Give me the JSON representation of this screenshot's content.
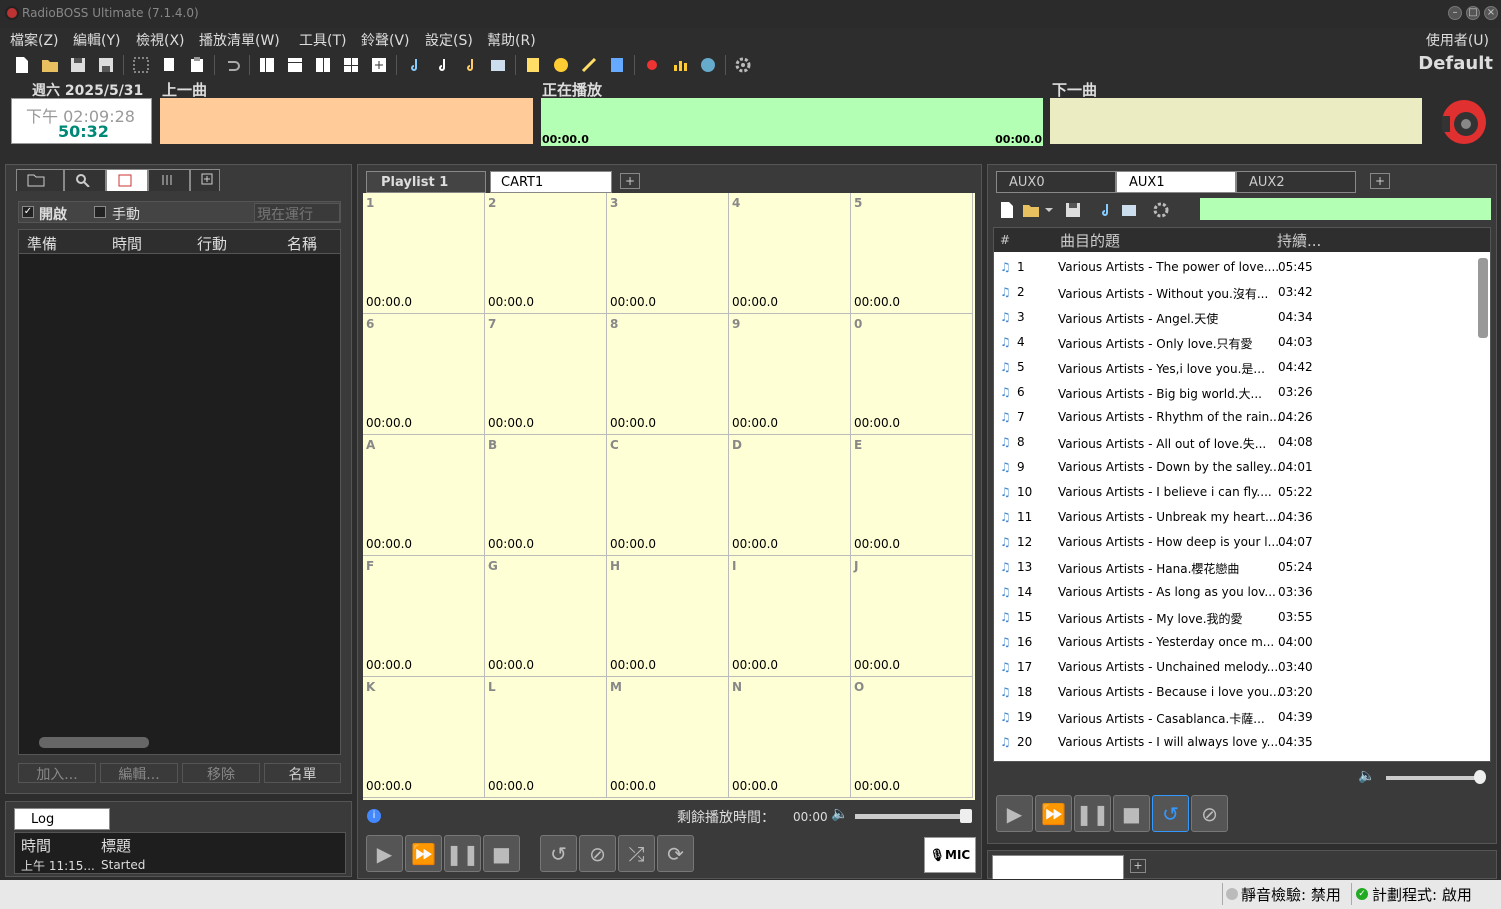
{
  "window": {
    "title": "RadioBOSS Ultimate (7.1.4.0)"
  },
  "menu": {
    "items": [
      "檔案(Z)",
      "編輯(Y)",
      "檢視(X)",
      "播放清單(W)",
      "工具(T)",
      "鈴聲(V)",
      "設定(S)",
      "幫助(R)"
    ],
    "user": "使用者(U)"
  },
  "profile": "Default",
  "clock": {
    "date": "週六 2025/5/31",
    "time": "下午 02:09:28",
    "countdown": "50:32"
  },
  "headers": {
    "previous": "上一曲",
    "now_playing": "正在播放",
    "next": "下一曲"
  },
  "now_playing": {
    "elapsed": "00:00.0",
    "remaining": "00:00.0"
  },
  "scheduler": {
    "enabled_label": "開啟",
    "manual_label": "手動",
    "run_now": "現在運行",
    "columns": [
      "準備",
      "時間",
      "行動",
      "名稱"
    ],
    "buttons": [
      "加入...",
      "編輯...",
      "移除",
      "名單"
    ]
  },
  "log": {
    "tab": "Log",
    "columns": [
      "時間",
      "標題"
    ],
    "entries": [
      {
        "time": "上午 11:15...",
        "title": "Started"
      }
    ]
  },
  "center": {
    "tabs": [
      "Playlist 1",
      "CART1"
    ],
    "remaining_label": "剩餘播放時間：",
    "remaining_value": "00:00",
    "mic_label": "MIC",
    "carts": [
      "1",
      "2",
      "3",
      "4",
      "5",
      "6",
      "7",
      "8",
      "9",
      "0",
      "A",
      "B",
      "C",
      "D",
      "E",
      "F",
      "G",
      "H",
      "I",
      "J",
      "K",
      "L",
      "M",
      "N",
      "O"
    ],
    "cart_time": "00:00.0"
  },
  "right": {
    "tabs": [
      "AUX0",
      "AUX1",
      "AUX2"
    ],
    "columns": [
      "#",
      "曲目的題",
      "持續..."
    ],
    "tracks": [
      {
        "n": "1",
        "title": "Various Artists - The power of love....",
        "dur": "05:45"
      },
      {
        "n": "2",
        "title": "Various Artists - Without you.沒有...",
        "dur": "03:42"
      },
      {
        "n": "3",
        "title": "Various Artists - Angel.天使",
        "dur": "04:34"
      },
      {
        "n": "4",
        "title": "Various Artists - Only love.只有愛",
        "dur": "04:03"
      },
      {
        "n": "5",
        "title": "Various Artists - Yes,i love you.是...",
        "dur": "04:42"
      },
      {
        "n": "6",
        "title": "Various Artists - Big big world.大...",
        "dur": "03:26"
      },
      {
        "n": "7",
        "title": "Various Artists - Rhythm of the rain....",
        "dur": "04:26"
      },
      {
        "n": "8",
        "title": "Various Artists - All out of love.失...",
        "dur": "04:08"
      },
      {
        "n": "9",
        "title": "Various Artists - Down by the salley...",
        "dur": "04:01"
      },
      {
        "n": "10",
        "title": "Various Artists - I believe i can fly....",
        "dur": "05:22"
      },
      {
        "n": "11",
        "title": "Various Artists - Unbreak my heart....",
        "dur": "04:36"
      },
      {
        "n": "12",
        "title": "Various Artists - How deep is your l...",
        "dur": "04:07"
      },
      {
        "n": "13",
        "title": "Various Artists - Hana.櫻花戀曲",
        "dur": "05:24"
      },
      {
        "n": "14",
        "title": "Various Artists - As long as you lov...",
        "dur": "03:36"
      },
      {
        "n": "15",
        "title": "Various Artists - My love.我的愛",
        "dur": "03:55"
      },
      {
        "n": "16",
        "title": "Various Artists - Yesterday once m...",
        "dur": "04:00"
      },
      {
        "n": "17",
        "title": "Various Artists - Unchained melody...",
        "dur": "03:40"
      },
      {
        "n": "18",
        "title": "Various Artists - Because i love you....",
        "dur": "03:20"
      },
      {
        "n": "19",
        "title": "Various Artists - Casablanca.卡薩...",
        "dur": "04:39"
      },
      {
        "n": "20",
        "title": "Various Artists - I will always love y...",
        "dur": "04:35"
      }
    ]
  },
  "status": {
    "silence": "靜音檢驗: 禁用",
    "scheduler": "計劃程式: 啟用"
  },
  "colors": {
    "prev": "#ffcc99",
    "now": "#b3ffb3",
    "next": "#ececc2",
    "cart": "#ffffd6"
  }
}
